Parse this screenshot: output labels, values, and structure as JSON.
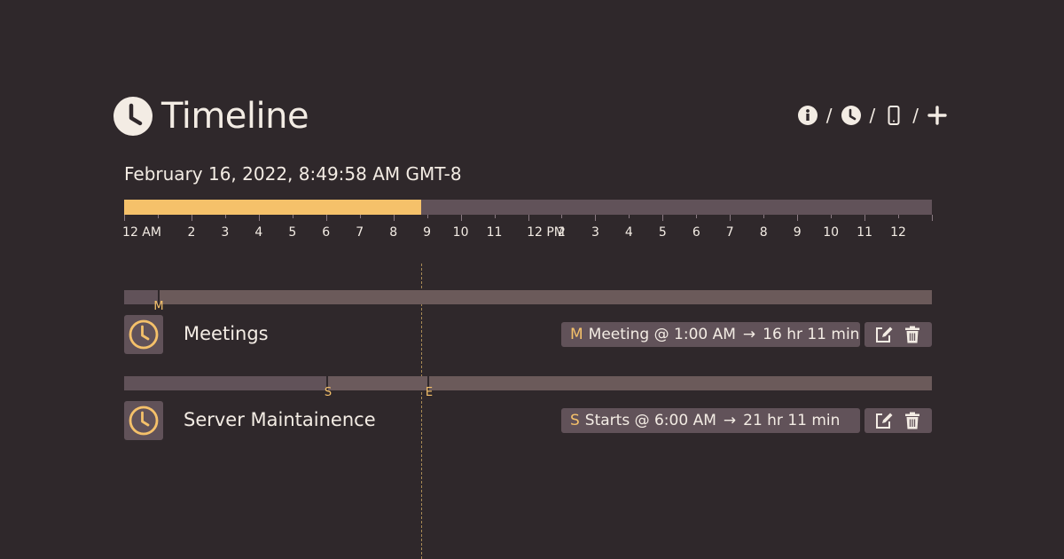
{
  "header": {
    "title": "Timeline",
    "toolbar": [
      {
        "icon": "info-icon",
        "sep": "/"
      },
      {
        "icon": "clock-icon",
        "sep": "/"
      },
      {
        "icon": "phone-icon",
        "sep": "/"
      },
      {
        "icon": "plus-icon",
        "sep": ""
      }
    ]
  },
  "datetime": "February 16, 2022, 8:49:58 AM GMT-8",
  "day": {
    "progress": 0.368,
    "hour_labels": [
      "12 AM",
      "2",
      "3",
      "4",
      "5",
      "6",
      "7",
      "8",
      "9",
      "10",
      "11",
      "12 PM",
      "2",
      "3",
      "4",
      "5",
      "6",
      "7",
      "8",
      "9",
      "10",
      "11",
      "12"
    ],
    "accent_color": "#f5c16a"
  },
  "events": [
    {
      "name": "Meetings",
      "markers": [
        {
          "letter": "M",
          "time": "1:00 AM"
        }
      ],
      "summary_letter": "M",
      "summary": "Meeting @ 1:00 AM",
      "arrow": "→",
      "duration": "16 hr 11 min"
    },
    {
      "name": "Server Maintainence",
      "markers": [
        {
          "letter": "S",
          "time": "6:00 AM"
        },
        {
          "letter": "E",
          "time": ""
        }
      ],
      "summary_letter": "S",
      "summary": "Starts @ 6:00 AM",
      "arrow": "→",
      "duration": "21 hr 11 min"
    }
  ]
}
